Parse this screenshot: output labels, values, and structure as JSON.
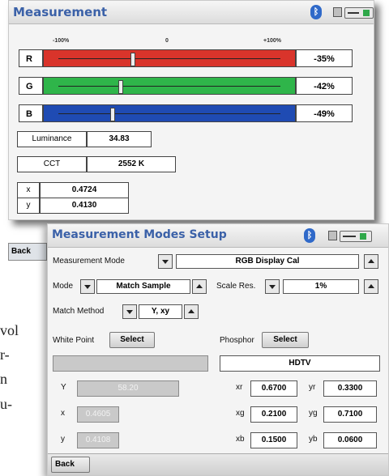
{
  "measurement_window": {
    "title": "Measurement",
    "scale": {
      "left": "-100%",
      "center": "0",
      "right": "+100%"
    },
    "channels": [
      {
        "letter": "R",
        "value": "-35%",
        "color": "#d9342b",
        "offset": -0.35
      },
      {
        "letter": "G",
        "value": "-42%",
        "color": "#2fb54a",
        "offset": -0.42
      },
      {
        "letter": "B",
        "value": "-49%",
        "color": "#1f4bb3",
        "offset": -0.49
      }
    ],
    "luminance": {
      "label": "Luminance",
      "value": "34.83"
    },
    "cct": {
      "label": "CCT",
      "value": "2552 K"
    },
    "xy": [
      {
        "label": "x",
        "value": "0.4724"
      },
      {
        "label": "y",
        "value": "0.4130"
      }
    ],
    "back_label": "Back"
  },
  "left_text": [
    "vol",
    "r-",
    "n",
    "u-"
  ],
  "modes_window": {
    "title": "Measurement Modes Setup",
    "measurement_mode": {
      "label": "Measurement Mode",
      "value": "RGB Display Cal"
    },
    "mode": {
      "label": "Mode",
      "value": "Match Sample"
    },
    "scale_res": {
      "label": "Scale Res.",
      "value": "1%"
    },
    "match_method": {
      "label": "Match Method",
      "value": "Y, xy"
    },
    "white_point": {
      "label": "White Point",
      "button": "Select",
      "field": ""
    },
    "phosphor": {
      "label": "Phosphor",
      "button": "Select",
      "field": "HDTV"
    },
    "white_values": [
      {
        "label": "Y",
        "value": "58.20"
      },
      {
        "label": "x",
        "value": "0.4605"
      },
      {
        "label": "y",
        "value": "0.4108"
      }
    ],
    "phosphor_values": [
      {
        "l1": "xr",
        "v1": "0.6700",
        "l2": "yr",
        "v2": "0.3300"
      },
      {
        "l1": "xg",
        "v1": "0.2100",
        "l2": "yg",
        "v2": "0.7100"
      },
      {
        "l1": "xb",
        "v1": "0.1500",
        "l2": "yb",
        "v2": "0.0600"
      }
    ],
    "back_label": "Back"
  },
  "colors": {
    "title_blue": "#3b61a8",
    "bluetooth_blue": "#2f69c9"
  }
}
